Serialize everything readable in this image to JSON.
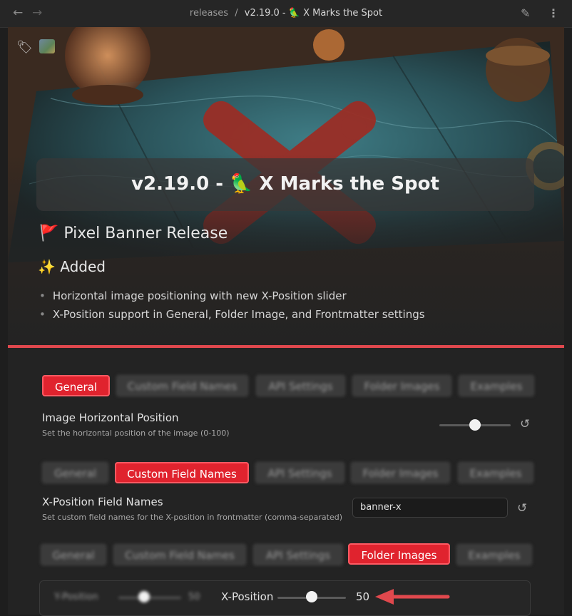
{
  "topbar": {
    "back_icon": "arrow-left-icon",
    "forward_icon": "arrow-right-icon",
    "breadcrumb_parent": "releases",
    "breadcrumb_sep": "/",
    "breadcrumb_current": "v2.19.0 - 🦜 X Marks the Spot",
    "edit_icon": "pencil-icon",
    "more_icon": "more-vertical-icon"
  },
  "banner": {
    "title": "v2.19.0 - 🦜 X Marks the Spot"
  },
  "note": {
    "heading": "🚩 Pixel Banner Release",
    "section": "✨ Added",
    "bullets": [
      "Horizontal image positioning with new X-Position slider",
      "X-Position support in General, Folder Image, and Frontmatter settings"
    ]
  },
  "settings1": {
    "tabs": [
      "General",
      "Custom Field Names",
      "API Settings",
      "Folder Images",
      "Examples"
    ],
    "active_tab": "General",
    "label": "Image Horizontal Position",
    "desc": "Set the horizontal position of the image (0-100)",
    "slider_value": 50
  },
  "settings2": {
    "tabs": [
      "General",
      "Custom Field Names",
      "API Settings",
      "Folder Images",
      "Examples"
    ],
    "active_tab": "Custom Field Names",
    "label": "X-Position Field Names",
    "desc": "Set custom field names for the X-position in frontmatter (comma-separated)",
    "input_value": "banner-x"
  },
  "settings3": {
    "tabs": [
      "General",
      "Custom Field Names",
      "API Settings",
      "Folder Images",
      "Examples"
    ],
    "active_tab": "Folder Images",
    "blurred_label": "Y-Position",
    "blurred_value": "50",
    "xpos_label": "X-Position",
    "xpos_value": "50"
  },
  "colors": {
    "accent": "#e0232e",
    "arrow": "#e0484d"
  }
}
